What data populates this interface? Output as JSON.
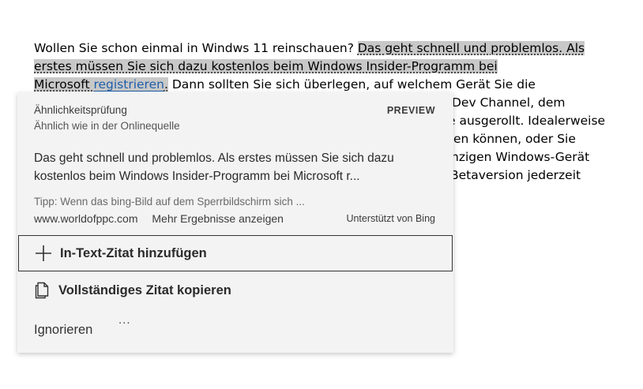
{
  "document": {
    "lines": [
      [
        "Wollen Sie schon einmal in Windws 11 reinschauen? ",
        "Das geht schnell und problemlos. Als "
      ],
      [
        "erstes müssen Sie sich dazu kostenlos beim Windows Insider-Programm bei "
      ],
      [
        "Microsoft ",
        "registrieren",
        ".",
        " Dann sollten Sie sich überlegen, auf welchem Gerät Sie die"
      ],
      [
        "Dev Channel, dem"
      ],
      [
        "e ausgerollt. Idealerweise"
      ],
      [
        "en können, oder Sie"
      ],
      [
        "nzigen Windows-Gerät"
      ],
      [
        "Betaversion jederzeit"
      ]
    ]
  },
  "card": {
    "title": "Ähnlichkeitsprüfung",
    "subtitle": "Ähnlich wie in der Onlinequelle",
    "preview_label": "PREVIEW",
    "excerpt": "Das geht schnell und problemlos. Als erstes müssen Sie sich dazu kostenlos beim Windows Insider-Programm bei Microsoft r...",
    "tip": "Tipp: Wenn das bing-Bild auf dem Sperrbildschirm sich ...",
    "source_url": "www.worldofppc.com",
    "more_results": "Mehr Ergebnisse anzeigen",
    "powered_by": "Unterstützt von Bing",
    "add_citation": "In-Text-Zitat hinzufügen",
    "copy_citation": "Vollständiges Zitat kopieren",
    "ignore": "Ignorieren",
    "more_dots": "..."
  },
  "icons": {
    "add": "plus-icon",
    "copy": "copy-icon",
    "more": "more-icon"
  },
  "colors": {
    "highlight": "#c8c8c8",
    "link": "#1f5fa8",
    "card_bg": "#f3f3f3"
  }
}
